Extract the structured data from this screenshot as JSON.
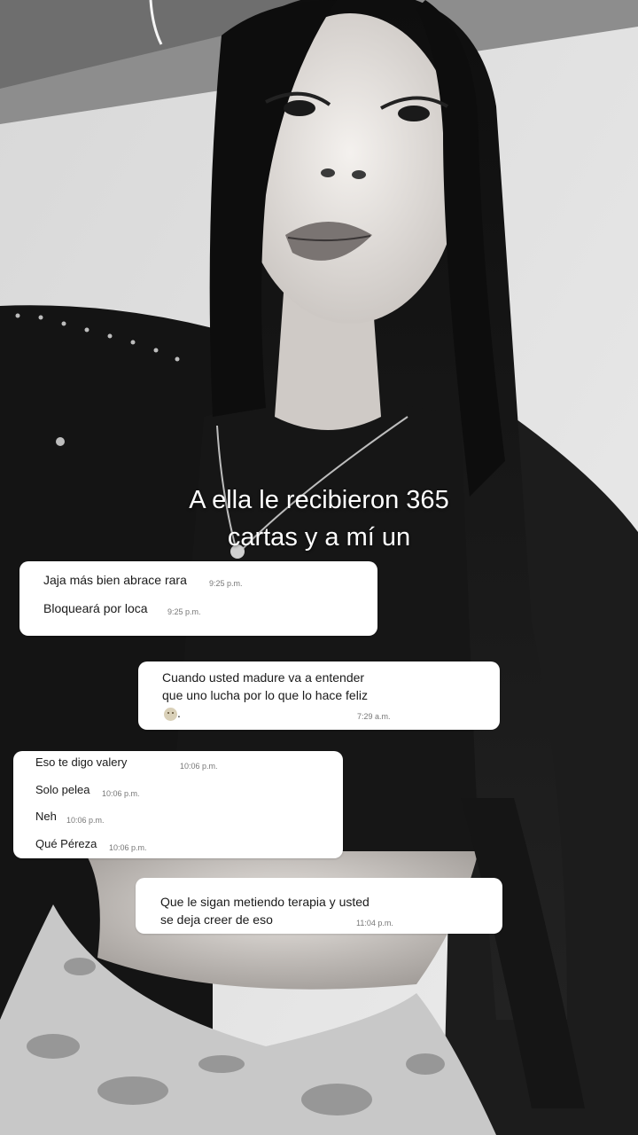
{
  "caption": {
    "line1": "A ella le recibieron 365",
    "line2": "cartas y a mí un"
  },
  "chat1": {
    "messages": [
      {
        "text": "Jaja más bien abrace rara",
        "time": "9:25 p.m."
      },
      {
        "text": "Bloqueará por loca",
        "time": "9:25 p.m."
      }
    ]
  },
  "chat2": {
    "line1": "Cuando usted madure va a entender",
    "line2": "que uno lucha por lo que lo hace feliz",
    "emoji_tail": ".",
    "time": "7:29 a.m.",
    "emoji_icon": "neutral-face-icon"
  },
  "chat3": {
    "messages": [
      {
        "text": "Eso te digo valery",
        "time": "10:06 p.m."
      },
      {
        "text": "Solo pelea",
        "time": "10:06 p.m."
      },
      {
        "text": "Neh",
        "time": "10:06 p.m."
      },
      {
        "text": "Qué Péreza",
        "time": "10:06 p.m."
      }
    ]
  },
  "chat4": {
    "line1": "Que le sigan metiendo terapia y usted",
    "line2": "se deja creer de eso",
    "time": "11:04 p.m."
  },
  "colors": {
    "bubble": "#ffffff",
    "text": "#1a1a1a",
    "timestamp": "#777777",
    "caption": "#ffffff"
  }
}
